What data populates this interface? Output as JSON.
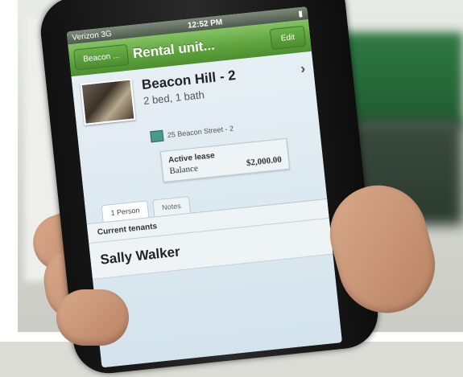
{
  "status_bar": {
    "carrier": "Verizon",
    "network": "3G",
    "time": "12:52 PM"
  },
  "nav_bar": {
    "back_label": "Beacon ...",
    "title": "Rental unit...",
    "edit_label": "Edit"
  },
  "unit": {
    "name": "Beacon Hill - 2",
    "beds_baths": "2 bed, 1 bath",
    "address": "25 Beacon Street - 2"
  },
  "lease": {
    "title": "Active lease",
    "balance_label": "Balance",
    "balance_value": "$2,000.00"
  },
  "tabs": [
    {
      "label": "1 Person"
    },
    {
      "label": "Notes"
    }
  ],
  "tenants": {
    "header": "Current tenants",
    "items": [
      {
        "name": "Sally Walker"
      }
    ]
  }
}
